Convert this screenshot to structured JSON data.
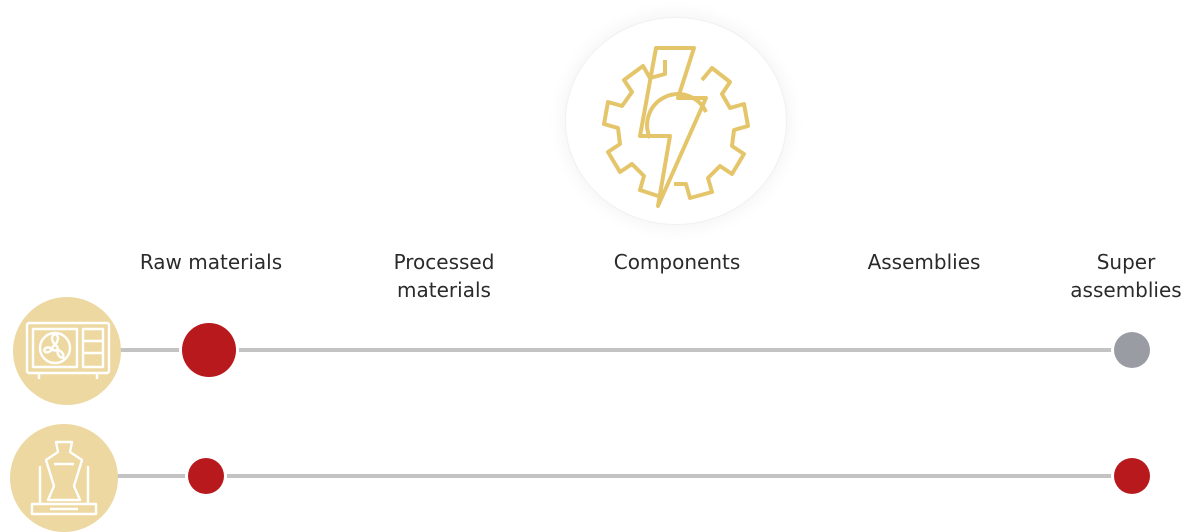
{
  "hero_icon": "gear-lightning-icon",
  "stages": [
    {
      "label": "Raw materials"
    },
    {
      "label": "Processed\nmaterials"
    },
    {
      "label": "Components"
    },
    {
      "label": "Assemblies"
    },
    {
      "label": "Super\nassemblies"
    }
  ],
  "rows": [
    {
      "icon": "air-conditioner-unit-icon",
      "start_stage": "Raw materials",
      "end_stage": "Super\nassemblies",
      "start_color": "#b8191c",
      "end_color": "#999da3"
    },
    {
      "icon": "casting-furnace-icon",
      "start_stage": "Raw materials",
      "end_stage": "Super\nassemblies",
      "start_color": "#b8191c",
      "end_color": "#b8191c"
    }
  ],
  "colors": {
    "gold": "#e5c56a",
    "icon_bg": "#ecd8a0",
    "line": "#c3c3c3"
  }
}
